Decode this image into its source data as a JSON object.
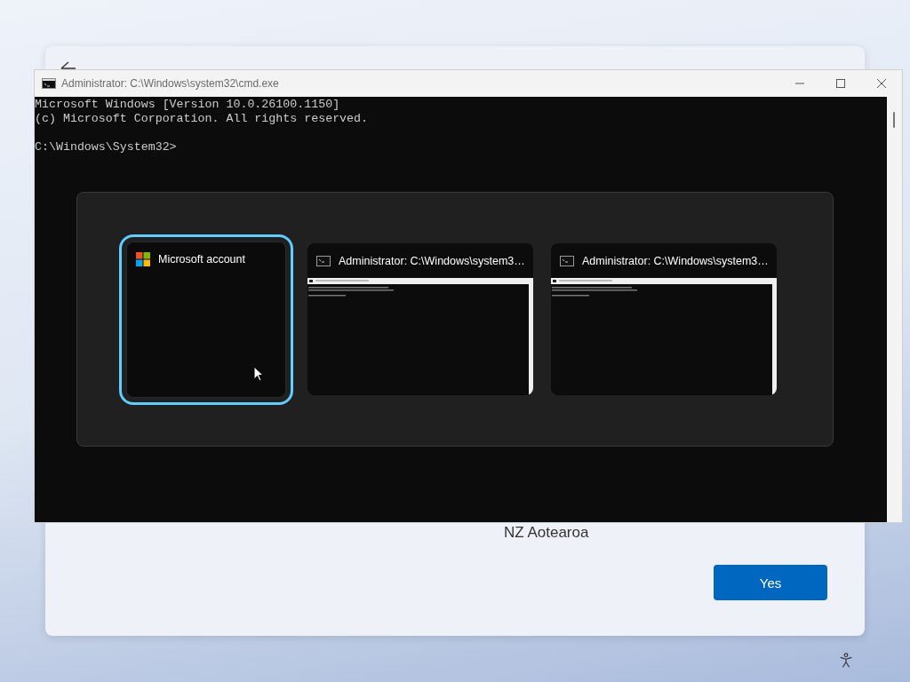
{
  "setup_page": {
    "region_text": "NZ Aotearoa",
    "primary_button": "Yes"
  },
  "console_window": {
    "title": "Administrator: C:\\Windows\\system32\\cmd.exe",
    "header_lines": [
      "Microsoft Windows [Version 10.0.26100.1150]",
      "(c) Microsoft Corporation. All rights reserved."
    ],
    "prompt": "C:\\Windows\\System32>"
  },
  "task_switcher": {
    "items": [
      {
        "kind": "app",
        "title": "Microsoft account",
        "selected": true
      },
      {
        "kind": "console",
        "title": "Administrator: C:\\Windows\\system3…",
        "selected": false
      },
      {
        "kind": "console",
        "title": "Administrator: C:\\Windows\\system3…",
        "selected": false
      }
    ]
  }
}
